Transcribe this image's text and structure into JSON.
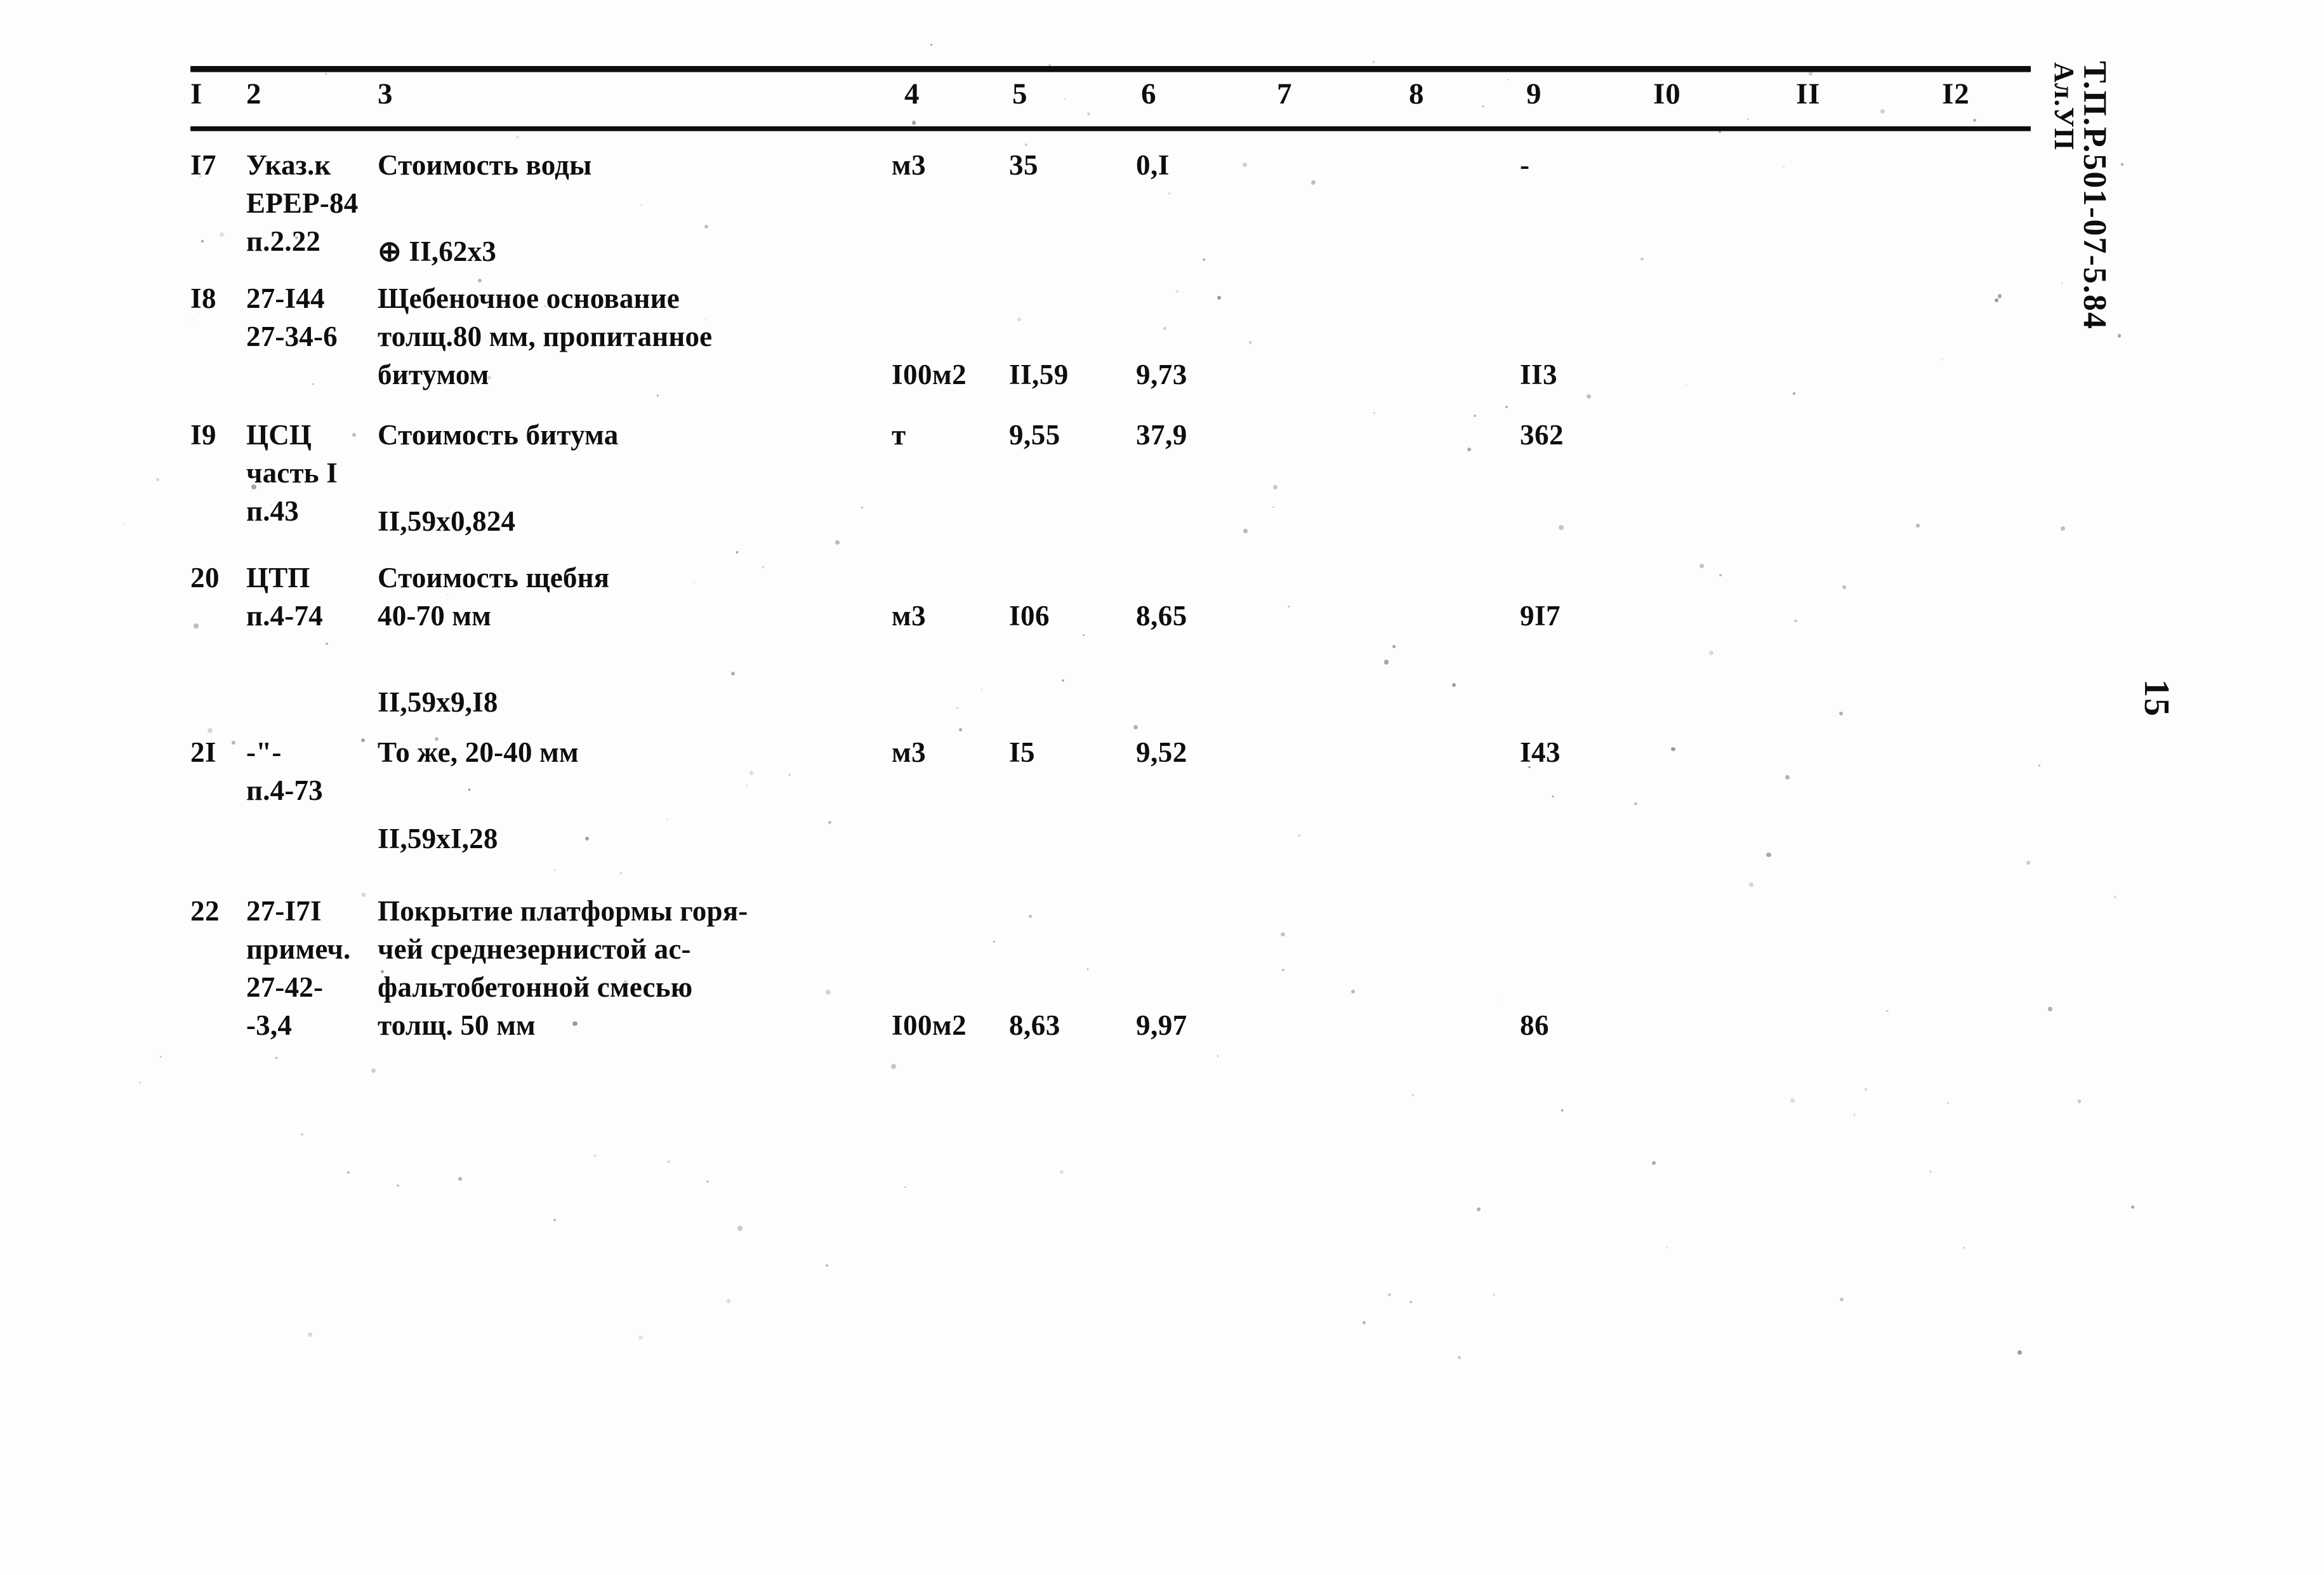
{
  "document": {
    "code": "Т.П.Р.501-07-5.84",
    "album": "Ал.УП",
    "page_number": "15"
  },
  "table": {
    "column_headers": [
      "I",
      "2",
      "3",
      "4",
      "5",
      "6",
      "7",
      "8",
      "9",
      "I0",
      "II",
      "I2"
    ],
    "rows": [
      {
        "n": "I7",
        "code_lines": [
          "Указ.к",
          "ЕРЕР-84",
          "п.2.22"
        ],
        "desc_lines": [
          "Стоимость воды"
        ],
        "calc": "⊕ II,62х3",
        "unit": "м3",
        "c5": "35",
        "c6": "0,I",
        "c9": "-"
      },
      {
        "n": "I8",
        "code_lines": [
          "27-I44",
          "27-34-6"
        ],
        "desc_lines": [
          "Щебеночное основание",
          "толщ.80 мм, пропитанное",
          "битумом"
        ],
        "calc": "",
        "unit": "I00м2",
        "c5": "II,59",
        "c6": "9,73",
        "c9": "II3"
      },
      {
        "n": "I9",
        "code_lines": [
          "ЦСЦ",
          "часть I",
          "п.43"
        ],
        "desc_lines": [
          "Стоимость битума"
        ],
        "calc": "II,59х0,824",
        "unit": "т",
        "c5": "9,55",
        "c6": "37,9",
        "c9": "362"
      },
      {
        "n": "20",
        "code_lines": [
          "ЦТП",
          "п.4-74"
        ],
        "desc_lines": [
          "Стоимость щебня",
          "40-70 мм"
        ],
        "calc": "II,59х9,I8",
        "unit": "м3",
        "c5": "I06",
        "c6": "8,65",
        "c9": "9I7"
      },
      {
        "n": "2I",
        "code_lines": [
          "-\"-",
          "п.4-73"
        ],
        "desc_lines": [
          "То же, 20-40 мм"
        ],
        "calc": "II,59хI,28",
        "unit": "м3",
        "c5": "I5",
        "c6": "9,52",
        "c9": "I43"
      },
      {
        "n": "22",
        "code_lines": [
          "27-I7I",
          "примеч.",
          "27-42-",
          "-3,4"
        ],
        "desc_lines": [
          "Покрытие платформы горя-",
          "чей среднезернистой ас-",
          "фальтобетонной смесью",
          "толщ. 50 мм"
        ],
        "calc": "",
        "unit": "I00м2",
        "c5": "8,63",
        "c6": "9,97",
        "c9": "86"
      }
    ]
  }
}
